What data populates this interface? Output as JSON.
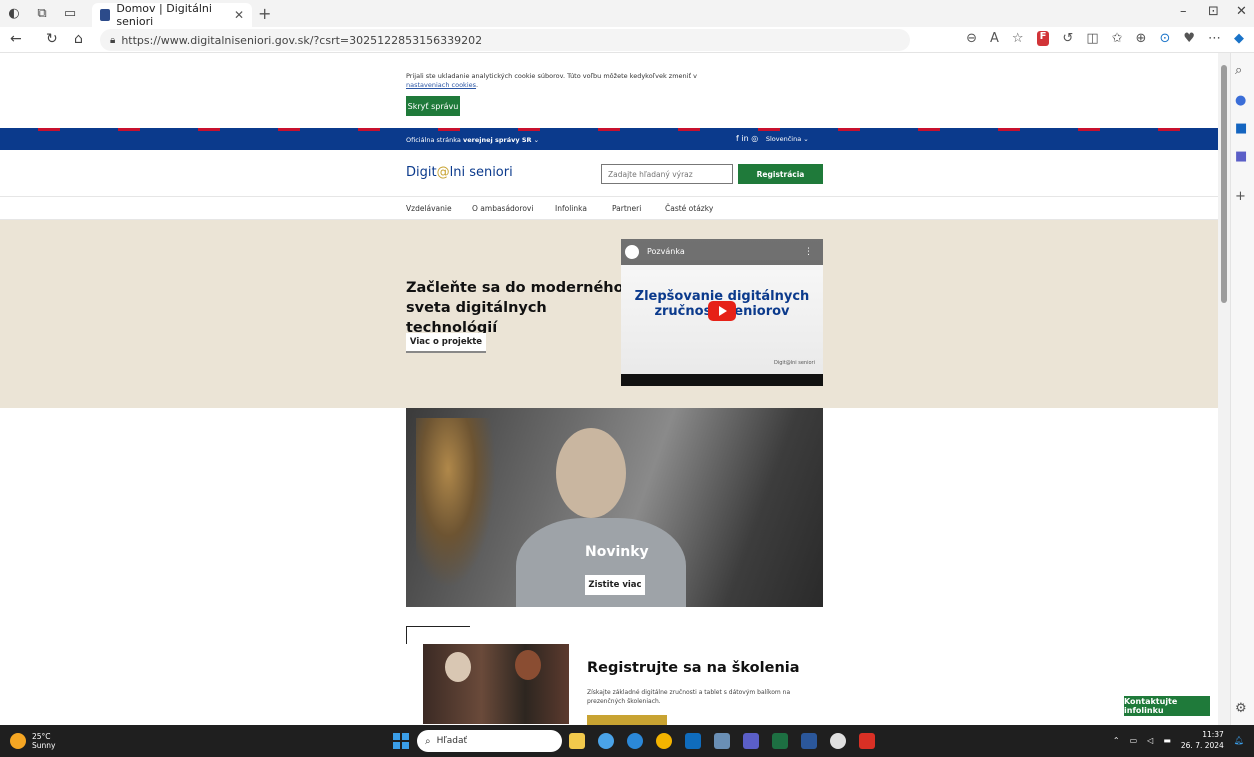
{
  "browser": {
    "tab_title": "Domov | Digitálni seniori",
    "url": "https://www.digitalniseniori.gov.sk/?csrt=3025122853156339202"
  },
  "cookie": {
    "text": "Prijali ste ukladanie analytických cookie súborov. Túto voľbu môžete kedykoľvek zmeniť v",
    "link": "nastaveniach cookies",
    "link_suffix": ".",
    "hide_button": "Skryť správu"
  },
  "gov_bar": {
    "prefix": "Oficiálna stránka",
    "bold": "verejnej správy SR",
    "caret": "⌄",
    "social": "f  in  ◎",
    "language": "Slovenčina",
    "language_caret": "⌄"
  },
  "header": {
    "logo_part1": "Digit",
    "logo_at": "@",
    "logo_part2": "lni seniori",
    "search_placeholder": "Zadajte hľadaný výraz",
    "register_button": "Registrácia"
  },
  "menu": {
    "items": [
      "Vzdelávanie",
      "O ambasádorovi",
      "Infolinka",
      "Partneri",
      "Časté otázky"
    ]
  },
  "hero": {
    "title": "Začleňte sa do moderného sveta digitálnych technológií",
    "button": "Viac o projekte",
    "video_title": "Pozvánka",
    "video_text": "Zlepšovanie digitálnych zručností seniorov",
    "video_watermark": "Digit@lni seniori"
  },
  "news": {
    "title": "Novinky",
    "button": "Zistite viac"
  },
  "training": {
    "title": "Registrujte sa na školenia",
    "text": "Získajte základné digitálne zručnosti a tablet s dátovým balíkom na prezenčných školeniach."
  },
  "floating": {
    "contact_button": "Kontaktujte infolinku"
  },
  "taskbar": {
    "temperature": "25°C",
    "weather": "Sunny",
    "search_placeholder": "Hľadať",
    "time": "11:37",
    "date": "26. 7. 2024"
  }
}
